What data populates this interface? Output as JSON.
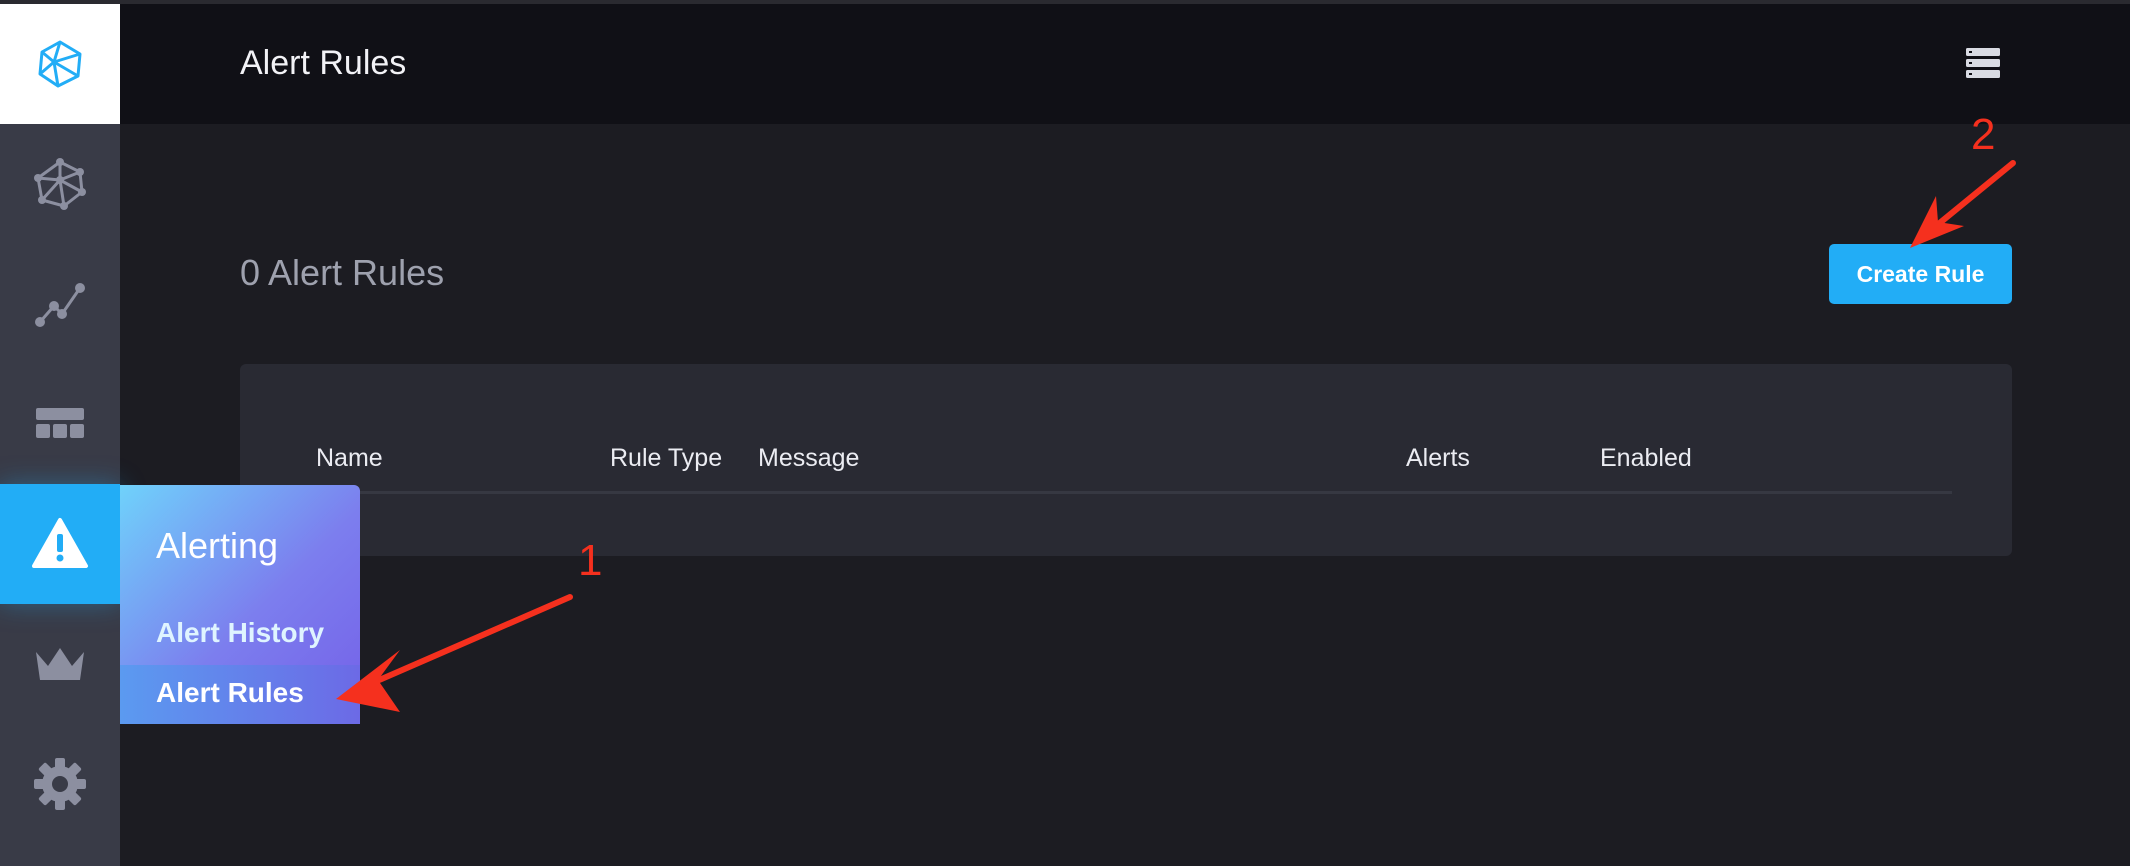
{
  "header": {
    "title": "Alert Rules",
    "menu_icon": "server-list-icon"
  },
  "sidebar": {
    "logo_icon": "logo-polyhedron-icon",
    "items": [
      {
        "icon": "network-icon",
        "active": false
      },
      {
        "icon": "graph-icon",
        "active": false
      },
      {
        "icon": "dashboard-grid-icon",
        "active": false
      },
      {
        "icon": "warning-icon",
        "active": true
      },
      {
        "icon": "crown-icon",
        "active": false
      },
      {
        "icon": "gear-icon",
        "active": false
      }
    ]
  },
  "flyout": {
    "heading": "Alerting",
    "links": [
      {
        "label": "Alert History",
        "active": false
      },
      {
        "label": "Alert Rules",
        "active": true
      }
    ]
  },
  "main": {
    "count_title": "0 Alert Rules",
    "create_button": "Create Rule",
    "table": {
      "columns": [
        "Name",
        "Rule Type",
        "Message",
        "Alerts",
        "Enabled"
      ],
      "rows": []
    }
  },
  "annotations": {
    "one": "1",
    "two": "2",
    "color": "#f5301e"
  },
  "colors": {
    "accent": "#22adf6",
    "header_bg": "#101016",
    "sidebar_bg": "#393b47",
    "page_bg": "#1c1c22"
  }
}
